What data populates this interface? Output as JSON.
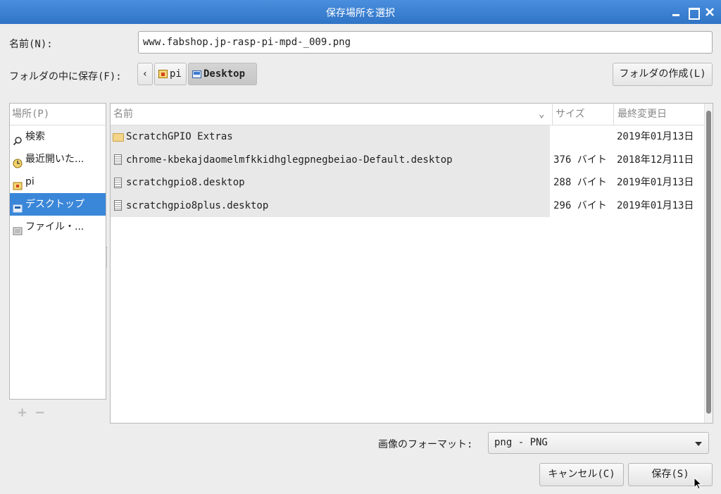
{
  "window": {
    "title": "保存場所を選択"
  },
  "name_field": {
    "label": "名前(N):",
    "value": "www.fabshop.jp-rasp-pi-mpd-_009.png"
  },
  "folder_path": {
    "label": "フォルダの中に保存(F):",
    "back_glyph": "‹",
    "crumbs": [
      "pi",
      "Desktop"
    ]
  },
  "create_folder_label": "フォルダの作成(L)",
  "places": {
    "header": "場所(P)",
    "items": [
      {
        "label": "検索",
        "icon": "search-icon"
      },
      {
        "label": "最近開いた...",
        "icon": "recent-icon"
      },
      {
        "label": "pi",
        "icon": "home-folder-icon"
      },
      {
        "label": "デスクトップ",
        "icon": "desktop-icon",
        "selected": true
      },
      {
        "label": "ファイル・...",
        "icon": "filesystem-icon"
      }
    ],
    "add_glyph": "+",
    "remove_glyph": "−"
  },
  "file_list": {
    "columns": {
      "name": "名前",
      "size": "サイズ",
      "modified": "最終変更日"
    },
    "rows": [
      {
        "name": "ScratchGPIO Extras",
        "size": "",
        "modified": "2019年01月13日",
        "type": "folder"
      },
      {
        "name": "chrome-kbekajdaomelmfkkidhglegpnegbeiao-Default.desktop",
        "size": "376 バイト",
        "modified": "2018年12月11日",
        "type": "file"
      },
      {
        "name": "scratchgpio8.desktop",
        "size": "288 バイト",
        "modified": "2019年01月13日",
        "type": "file"
      },
      {
        "name": "scratchgpio8plus.desktop",
        "size": "296 バイト",
        "modified": "2019年01月13日",
        "type": "file"
      }
    ]
  },
  "format": {
    "label": "画像のフォーマット:",
    "selected": "png - PNG"
  },
  "buttons": {
    "cancel": "キャンセル(C)",
    "save": "保存(S)"
  },
  "colors": {
    "titlebar": "#3a7fd0",
    "selection": "#3a86d9"
  }
}
